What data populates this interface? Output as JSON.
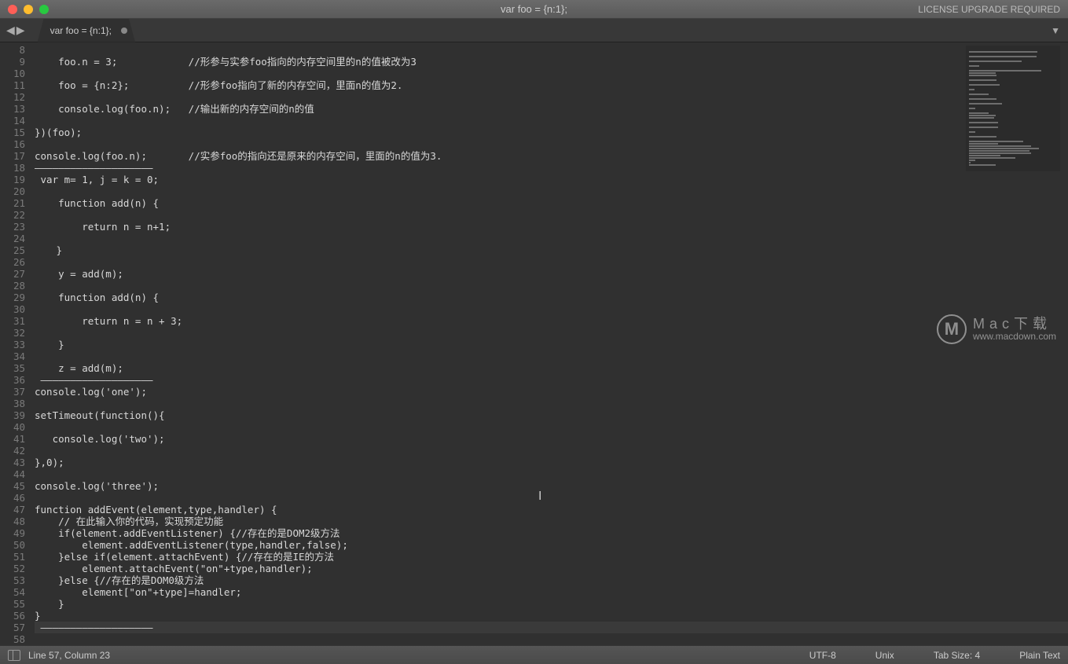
{
  "window": {
    "title": "var foo = {n:1};",
    "license_warning": "LICENSE UPGRADE REQUIRED"
  },
  "tabs": [
    {
      "label": "var foo = {n:1};",
      "modified": true
    }
  ],
  "editor": {
    "first_line_number": 8,
    "highlighted_line": 57,
    "lines": [
      "",
      "    foo.n = 3;            //形参与实参foo指向的内存空间里的n的值被改为3",
      "",
      "    foo = {n:2};          //形参foo指向了新的内存空间，里面n的值为2.",
      "",
      "    console.log(foo.n);   //输出新的内存空间的n的值",
      "",
      "})(foo);",
      "",
      "console.log(foo.n);       //实参foo的指向还是原来的内存空间，里面的n的值为3.",
      "————————————————————",
      " var m= 1, j = k = 0;",
      "  ",
      "    function add(n) {",
      "  ",
      "        return n = n+1;",
      "  ",
      "  　}",
      "  ",
      "    y = add(m);",
      "  ",
      "    function add(n) {",
      "  ",
      "        return n = n + 3;",
      "  ",
      "    }",
      "  ",
      "    z = add(m);",
      " ———————————————————",
      "console.log('one');",
      "    ",
      "setTimeout(function(){",
      "    ",
      "   console.log('two');",
      "    ",
      "},0);",
      "    ",
      "console.log('three');",
      "",
      "function addEvent(element,type,handler) {",
      "    // 在此输入你的代码，实现预定功能",
      "    if(element.addEventListener) {//存在的是DOM2级方法",
      "        element.addEventListener(type,handler,false);",
      "    }else if(element.attachEvent) {//存在的是IE的方法",
      "        element.attachEvent(\"on\"+type,handler);",
      "    }else {//存在的是DOM0级方法",
      "        element[\"on\"+type]=handler;",
      "    }",
      "}",
      " ———————————————————",
      ""
    ]
  },
  "status_bar": {
    "position": "Line 57, Column 23",
    "encoding": "UTF-8",
    "line_endings": "Unix",
    "tab_size": "Tab Size: 4",
    "syntax": "Plain Text"
  },
  "watermark": {
    "line1": "Mac下载",
    "line2": "www.macdown.com"
  }
}
